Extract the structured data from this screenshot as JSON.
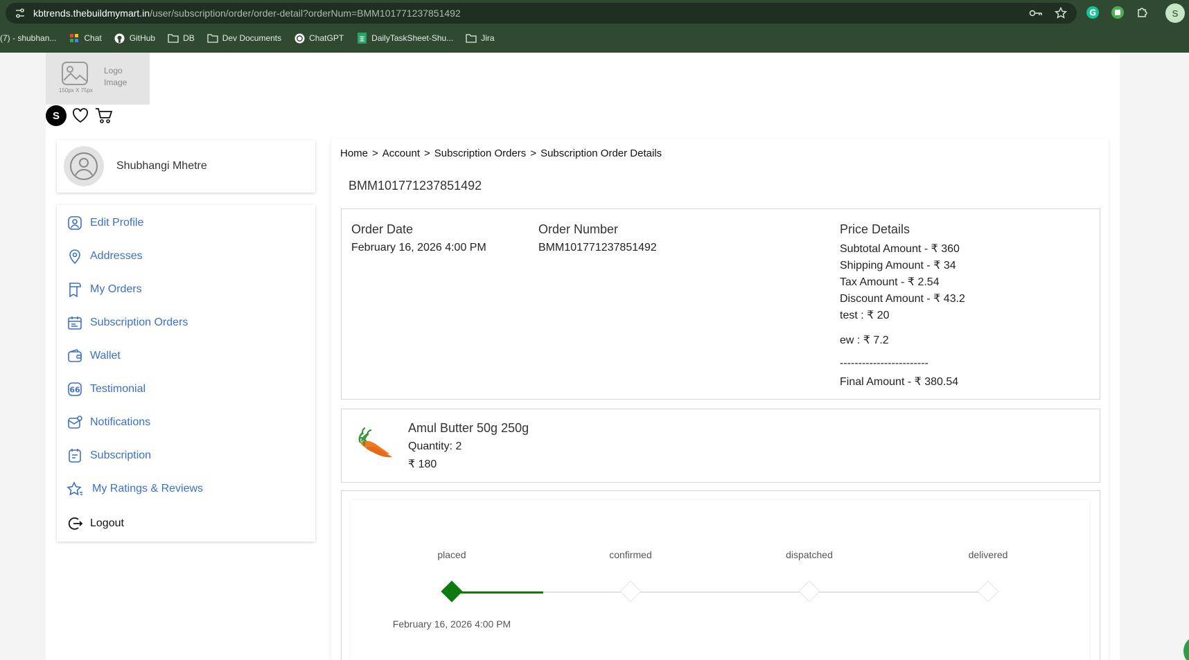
{
  "browser": {
    "url_host": "kbtrends.thebuildmymart.in",
    "url_path": "/user/subscription/order/order-detail?orderNum=BMM101771237851492",
    "profile_initial": "S",
    "bookmarks": [
      {
        "label": "(7) - shubhan...",
        "icon": "page-icon"
      },
      {
        "label": "Chat",
        "icon": "chat-icon"
      },
      {
        "label": "GitHub",
        "icon": "github-icon"
      },
      {
        "label": "DB",
        "icon": "folder-icon"
      },
      {
        "label": "Dev Documents",
        "icon": "folder-icon"
      },
      {
        "label": "ChatGPT",
        "icon": "chatgpt-icon"
      },
      {
        "label": "DailyTaskSheet-Shu...",
        "icon": "sheets-icon"
      },
      {
        "label": "Jira",
        "icon": "folder-icon"
      }
    ]
  },
  "logo": {
    "label": "Logo Image",
    "size_note": "150px X 75px"
  },
  "header": {
    "user_initial": "S"
  },
  "profile": {
    "name": "Shubhangi Mhetre"
  },
  "menu": [
    {
      "label": "Edit Profile",
      "icon": "user-icon"
    },
    {
      "label": "Addresses",
      "icon": "location-icon"
    },
    {
      "label": "My Orders",
      "icon": "bookmark-icon"
    },
    {
      "label": "Subscription Orders",
      "icon": "calendar-icon"
    },
    {
      "label": "Wallet",
      "icon": "wallet-icon"
    },
    {
      "label": "Testimonial",
      "icon": "quote-icon"
    },
    {
      "label": "Notifications",
      "icon": "mail-notification-icon"
    },
    {
      "label": "Subscription",
      "icon": "subscription-icon"
    },
    {
      "label": "My Ratings & Reviews",
      "icon": "star-icon"
    },
    {
      "label": "Logout",
      "icon": "logout-icon"
    }
  ],
  "breadcrumb": [
    "Home",
    ">",
    "Account",
    ">",
    "Subscription Orders",
    ">",
    "Subscription Order Details"
  ],
  "order": {
    "id": "BMM101771237851492",
    "order_date_title": "Order Date",
    "order_date": "February 16, 2026 4:00 PM",
    "order_number_title": "Order Number",
    "order_number": "BMM101771237851492",
    "price_title": "Price Details",
    "price_lines": [
      "Subtotal Amount - ₹ 360",
      "Shipping Amount - ₹ 34",
      "Tax Amount - ₹ 2.54",
      "Discount Amount - ₹ 43.2",
      "test :  ₹ 20",
      "ew :  ₹ 7.2",
      "------------------------",
      "Final Amount - ₹ 380.54"
    ]
  },
  "product": {
    "name": "Amul Butter 50g 250g",
    "quantity": "Quantity: 2",
    "price": "₹ 180"
  },
  "tracking": {
    "steps": [
      "placed",
      "confirmed",
      "dispatched",
      "delivered"
    ],
    "completed_steps": 1,
    "progress_fraction": 0.17,
    "placed_date": "February 16, 2026 4:00 PM",
    "done_color": "#0f7a0f"
  }
}
